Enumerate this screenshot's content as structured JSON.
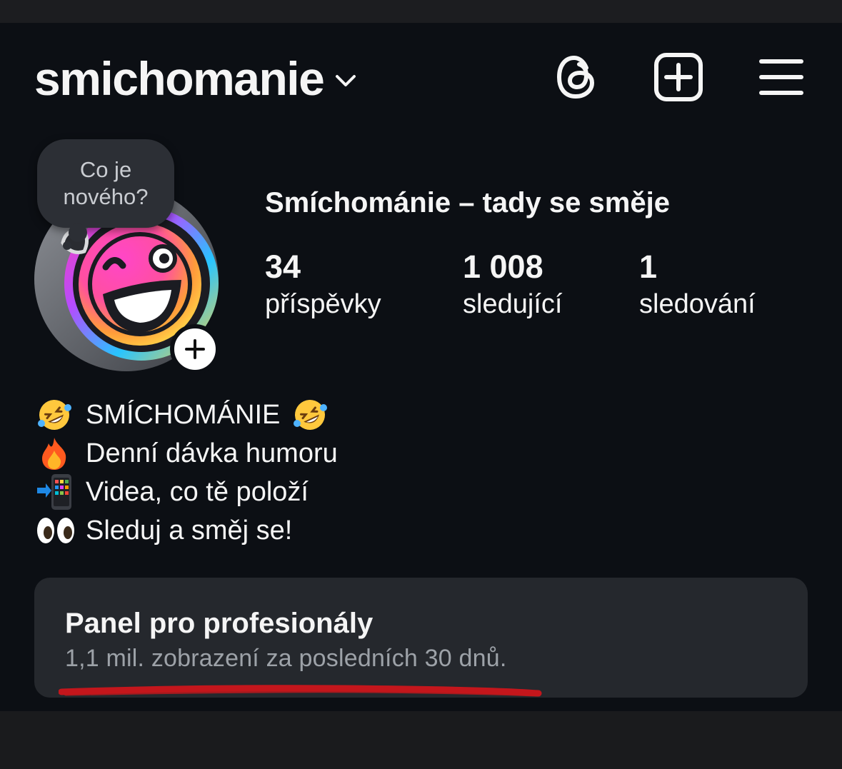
{
  "header": {
    "username": "smichomanie",
    "icons": [
      "chevron-down-icon",
      "threads-icon",
      "new-post-icon",
      "menu-icon"
    ]
  },
  "profile": {
    "note_prompt_line1": "Co je",
    "note_prompt_line2": "nového?",
    "display_name": "Smíchománie – tady se směje",
    "stats": [
      {
        "value": "34",
        "label": "příspěvky"
      },
      {
        "value": "1 008",
        "label": "sledující"
      },
      {
        "value": "1",
        "label": "sledování"
      }
    ]
  },
  "bio": [
    {
      "emoji": "rolling-on-floor-laughing-emoji",
      "text": "SMÍCHOMÁNIE",
      "trailing_emoji": "rolling-on-floor-laughing-emoji"
    },
    {
      "emoji": "fire-emoji",
      "text": "Denní dávka humoru"
    },
    {
      "emoji": "mobile-phone-arrow-emoji",
      "text": "Videa, co tě položí"
    },
    {
      "emoji": "eyes-emoji",
      "text": "Sleduj a směj se!"
    }
  ],
  "pro_panel": {
    "title": "Panel pro profesionály",
    "subtitle": "1,1 mil. zobrazení za posledních 30 dnů.",
    "annotation_color": "#c4161c"
  },
  "colors": {
    "background": "#0c0f14",
    "panel": "#25282d",
    "text": "#f5f5f5",
    "muted_text": "#9da2a8"
  }
}
